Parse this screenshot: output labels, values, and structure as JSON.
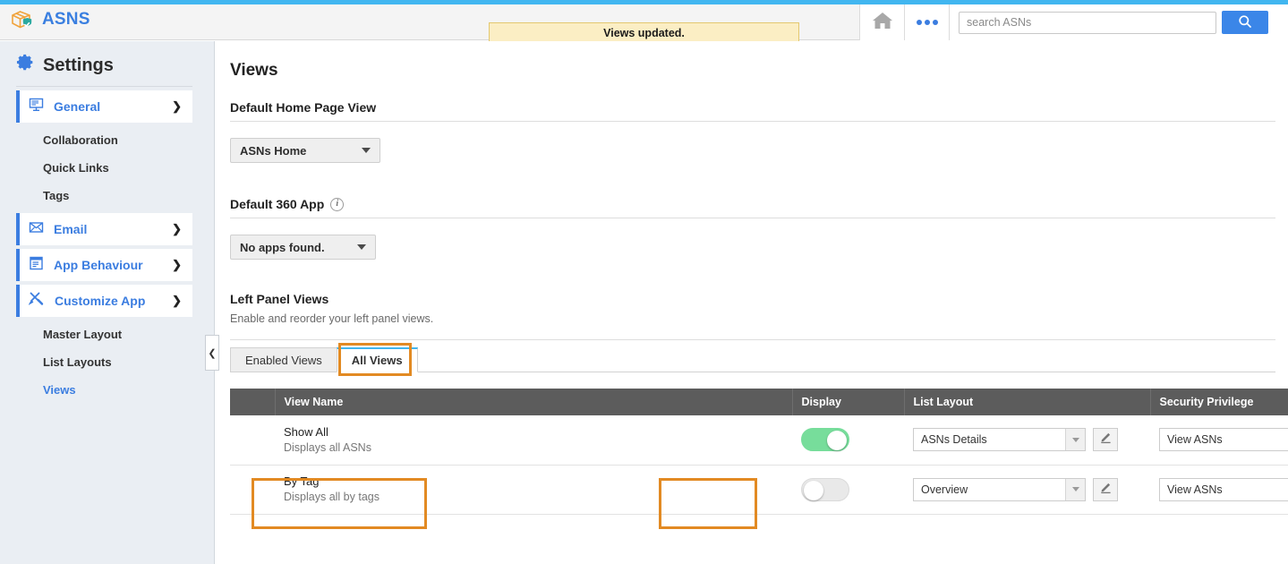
{
  "header": {
    "brand_name": "ASNS",
    "logo_icon": "package-shield-icon",
    "toast_message": "Views updated.",
    "home_icon": "home-icon",
    "more_icon": "more-dots-icon",
    "search_placeholder": "search ASNs",
    "search_value": "",
    "search_button_icon": "search-icon",
    "accent_color": "#41b6f0",
    "search_button_color": "#3b86e8"
  },
  "sidebar": {
    "title": "Settings",
    "gear_icon": "gear-icon",
    "collapse_icon": "chevron-left-icon",
    "groups": [
      {
        "label": "General",
        "icon": "monitor-icon",
        "chevron": "chevron-right-icon",
        "children": [
          "Collaboration",
          "Quick Links",
          "Tags"
        ]
      },
      {
        "label": "Email",
        "icon": "envelope-icon",
        "chevron": "chevron-right-icon",
        "children": []
      },
      {
        "label": "App Behaviour",
        "icon": "document-list-icon",
        "chevron": "chevron-right-icon",
        "children": []
      },
      {
        "label": "Customize App",
        "icon": "tools-icon",
        "chevron": "chevron-down-icon",
        "children": [
          "Master Layout",
          "List Layouts",
          "Views"
        ]
      }
    ],
    "active_child": "Views",
    "accent_color": "#3b7de0"
  },
  "main": {
    "page_title": "Views",
    "section_home": {
      "heading": "Default Home Page View",
      "select_value": "ASNs Home"
    },
    "section_app": {
      "heading": "Default 360 App",
      "info_icon": "info-icon",
      "select_value": "No apps found."
    },
    "section_left_panel": {
      "heading": "Left Panel Views",
      "description": "Enable and reorder your left panel views.",
      "tabs": [
        {
          "label": "Enabled Views",
          "active": false
        },
        {
          "label": "All Views",
          "active": true
        }
      ]
    },
    "table": {
      "columns": [
        "",
        "View Name",
        "Display",
        "List Layout",
        "Security Privilege"
      ],
      "rows": [
        {
          "name": "Show All",
          "description": "Displays all ASNs",
          "display_on": true,
          "list_layout": "ASNs Details",
          "security_privilege": "View ASNs",
          "edit_icon": "pencil-icon"
        },
        {
          "name": "By Tag",
          "description": "Displays all by tags",
          "display_on": false,
          "list_layout": "Overview",
          "security_privilege": "View ASNs",
          "edit_icon": "pencil-icon"
        }
      ],
      "header_bg": "#5c5c5c",
      "toggle_on_color": "#77dd9b",
      "toggle_off_color": "#e9e9e9"
    },
    "annotation_color": "#e28a23"
  }
}
